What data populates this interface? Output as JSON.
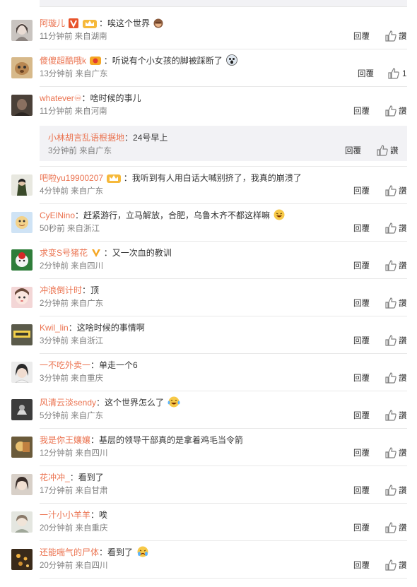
{
  "actions": {
    "reply_label": "回覆",
    "like_label": "讚"
  },
  "colors": {
    "username": "#eb7350",
    "meta": "#808080",
    "divider": "#e8e8e8",
    "subreply_bg": "#f2f2f5",
    "vip": "#f0a030"
  },
  "comments": [
    {
      "username": "阿璇儿",
      "text": "：唉这个世界",
      "meta": "11分钟前 来自湖南",
      "like_count": "",
      "badges": [
        "vip-badge",
        "crown-badge"
      ],
      "emoji_after": "monkey-emoji"
    },
    {
      "username": "傻傻超酷哦k",
      "text": "：听说有个小女孩的脚被踩断了",
      "meta": "13分钟前 来自广东",
      "like_count": "1",
      "badges": [
        "level-badge"
      ],
      "emoji_after": "scared-emoji"
    },
    {
      "username": "whatever♾",
      "text": "：啥时候的事儿",
      "meta": "11分钟前 来自河南",
      "like_count": ""
    },
    {
      "username": "小林胡言乱语根据地",
      "text": "：24号早上",
      "meta": "3分钟前 来自广东",
      "like_count": ""
    },
    {
      "username": "吧啦yu19900207",
      "text": "：我听到有人用白话大喊别挤了，我真的崩溃了",
      "meta": "4分钟前 来自广东",
      "like_count": "",
      "badges": [
        "crown-badge"
      ]
    },
    {
      "username": "CyElNino",
      "text": "：赶紧游行，立马解放，合肥，乌鲁木齐不都这样嘛",
      "meta": "50秒前 来自浙江",
      "like_count": "",
      "emoji_after": "laughing-emoji"
    },
    {
      "username": "求变S号猪花",
      "text": "：又一次血的教训",
      "meta": "2分钟前 来自四川",
      "like_count": "",
      "badges": [
        "v-badge"
      ]
    },
    {
      "username": "冲浪倒计时",
      "text": "：顶",
      "meta": "2分钟前 来自广东",
      "like_count": ""
    },
    {
      "username": "Kwil_lin",
      "text": "：这啥时候的事情啊",
      "meta": "3分钟前 来自浙江",
      "like_count": ""
    },
    {
      "username": "一不吃外卖一",
      "text": "：单走一个6",
      "meta": "3分钟前 来自重庆",
      "like_count": ""
    },
    {
      "username": "风清云淡sendy",
      "text": "：这个世界怎么了",
      "meta": "5分钟前 来自广东",
      "like_count": "",
      "emoji_after": "tears-laugh-emoji"
    },
    {
      "username": "我是你王孃孃",
      "text": "：基层的领导干部真的是拿着鸡毛当令箭",
      "meta": "12分钟前 来自四川",
      "like_count": ""
    },
    {
      "username": "花冲冲_",
      "text": "：看到了",
      "meta": "17分钟前 来自甘肃",
      "like_count": ""
    },
    {
      "username": "一汁小小羊羊",
      "text": "：唉",
      "meta": "20分钟前 来自重庆",
      "like_count": ""
    },
    {
      "username": "还能喘气的尸体",
      "text": "：看到了",
      "meta": "20分钟前 来自四川",
      "like_count": "",
      "emoji_after": "crying-emoji"
    }
  ]
}
